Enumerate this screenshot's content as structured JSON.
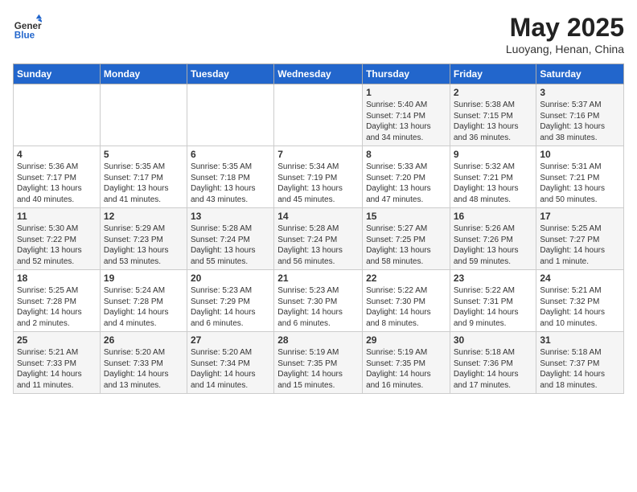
{
  "header": {
    "logo_general": "General",
    "logo_blue": "Blue",
    "month_title": "May 2025",
    "location": "Luoyang, Henan, China"
  },
  "weekdays": [
    "Sunday",
    "Monday",
    "Tuesday",
    "Wednesday",
    "Thursday",
    "Friday",
    "Saturday"
  ],
  "weeks": [
    [
      {
        "day": "",
        "info": ""
      },
      {
        "day": "",
        "info": ""
      },
      {
        "day": "",
        "info": ""
      },
      {
        "day": "",
        "info": ""
      },
      {
        "day": "1",
        "info": "Sunrise: 5:40 AM\nSunset: 7:14 PM\nDaylight: 13 hours\nand 34 minutes."
      },
      {
        "day": "2",
        "info": "Sunrise: 5:38 AM\nSunset: 7:15 PM\nDaylight: 13 hours\nand 36 minutes."
      },
      {
        "day": "3",
        "info": "Sunrise: 5:37 AM\nSunset: 7:16 PM\nDaylight: 13 hours\nand 38 minutes."
      }
    ],
    [
      {
        "day": "4",
        "info": "Sunrise: 5:36 AM\nSunset: 7:17 PM\nDaylight: 13 hours\nand 40 minutes."
      },
      {
        "day": "5",
        "info": "Sunrise: 5:35 AM\nSunset: 7:17 PM\nDaylight: 13 hours\nand 41 minutes."
      },
      {
        "day": "6",
        "info": "Sunrise: 5:35 AM\nSunset: 7:18 PM\nDaylight: 13 hours\nand 43 minutes."
      },
      {
        "day": "7",
        "info": "Sunrise: 5:34 AM\nSunset: 7:19 PM\nDaylight: 13 hours\nand 45 minutes."
      },
      {
        "day": "8",
        "info": "Sunrise: 5:33 AM\nSunset: 7:20 PM\nDaylight: 13 hours\nand 47 minutes."
      },
      {
        "day": "9",
        "info": "Sunrise: 5:32 AM\nSunset: 7:21 PM\nDaylight: 13 hours\nand 48 minutes."
      },
      {
        "day": "10",
        "info": "Sunrise: 5:31 AM\nSunset: 7:21 PM\nDaylight: 13 hours\nand 50 minutes."
      }
    ],
    [
      {
        "day": "11",
        "info": "Sunrise: 5:30 AM\nSunset: 7:22 PM\nDaylight: 13 hours\nand 52 minutes."
      },
      {
        "day": "12",
        "info": "Sunrise: 5:29 AM\nSunset: 7:23 PM\nDaylight: 13 hours\nand 53 minutes."
      },
      {
        "day": "13",
        "info": "Sunrise: 5:28 AM\nSunset: 7:24 PM\nDaylight: 13 hours\nand 55 minutes."
      },
      {
        "day": "14",
        "info": "Sunrise: 5:28 AM\nSunset: 7:24 PM\nDaylight: 13 hours\nand 56 minutes."
      },
      {
        "day": "15",
        "info": "Sunrise: 5:27 AM\nSunset: 7:25 PM\nDaylight: 13 hours\nand 58 minutes."
      },
      {
        "day": "16",
        "info": "Sunrise: 5:26 AM\nSunset: 7:26 PM\nDaylight: 13 hours\nand 59 minutes."
      },
      {
        "day": "17",
        "info": "Sunrise: 5:25 AM\nSunset: 7:27 PM\nDaylight: 14 hours\nand 1 minute."
      }
    ],
    [
      {
        "day": "18",
        "info": "Sunrise: 5:25 AM\nSunset: 7:28 PM\nDaylight: 14 hours\nand 2 minutes."
      },
      {
        "day": "19",
        "info": "Sunrise: 5:24 AM\nSunset: 7:28 PM\nDaylight: 14 hours\nand 4 minutes."
      },
      {
        "day": "20",
        "info": "Sunrise: 5:23 AM\nSunset: 7:29 PM\nDaylight: 14 hours\nand 6 minutes."
      },
      {
        "day": "21",
        "info": "Sunrise: 5:23 AM\nSunset: 7:30 PM\nDaylight: 14 hours\nand 6 minutes."
      },
      {
        "day": "22",
        "info": "Sunrise: 5:22 AM\nSunset: 7:30 PM\nDaylight: 14 hours\nand 8 minutes."
      },
      {
        "day": "23",
        "info": "Sunrise: 5:22 AM\nSunset: 7:31 PM\nDaylight: 14 hours\nand 9 minutes."
      },
      {
        "day": "24",
        "info": "Sunrise: 5:21 AM\nSunset: 7:32 PM\nDaylight: 14 hours\nand 10 minutes."
      }
    ],
    [
      {
        "day": "25",
        "info": "Sunrise: 5:21 AM\nSunset: 7:33 PM\nDaylight: 14 hours\nand 11 minutes."
      },
      {
        "day": "26",
        "info": "Sunrise: 5:20 AM\nSunset: 7:33 PM\nDaylight: 14 hours\nand 13 minutes."
      },
      {
        "day": "27",
        "info": "Sunrise: 5:20 AM\nSunset: 7:34 PM\nDaylight: 14 hours\nand 14 minutes."
      },
      {
        "day": "28",
        "info": "Sunrise: 5:19 AM\nSunset: 7:35 PM\nDaylight: 14 hours\nand 15 minutes."
      },
      {
        "day": "29",
        "info": "Sunrise: 5:19 AM\nSunset: 7:35 PM\nDaylight: 14 hours\nand 16 minutes."
      },
      {
        "day": "30",
        "info": "Sunrise: 5:18 AM\nSunset: 7:36 PM\nDaylight: 14 hours\nand 17 minutes."
      },
      {
        "day": "31",
        "info": "Sunrise: 5:18 AM\nSunset: 7:37 PM\nDaylight: 14 hours\nand 18 minutes."
      }
    ]
  ]
}
